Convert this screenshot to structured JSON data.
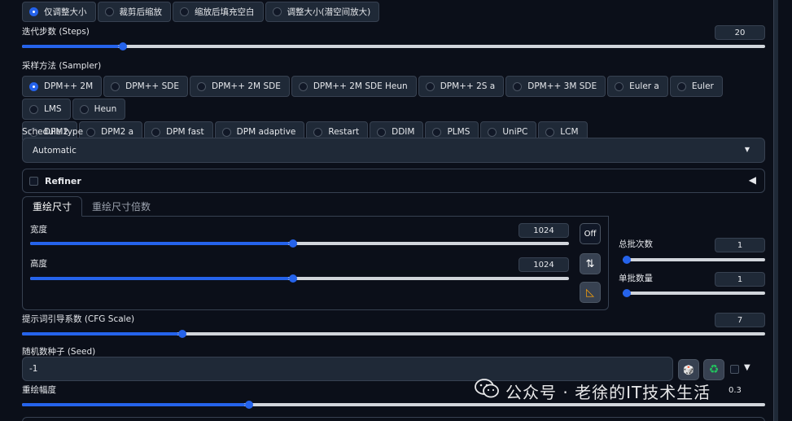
{
  "resize_mode": {
    "options": [
      "仅调整大小",
      "裁剪后缩放",
      "缩放后填充空白",
      "调整大小(潜空间放大)"
    ],
    "selected": 0
  },
  "steps": {
    "label": "迭代步数 (Steps)",
    "value": "20",
    "fraction": 0.13
  },
  "sampler": {
    "label": "采样方法 (Sampler)",
    "row1": [
      "DPM++ 2M",
      "DPM++ SDE",
      "DPM++ 2M SDE",
      "DPM++ 2M SDE Heun",
      "DPM++ 2S a",
      "DPM++ 3M SDE",
      "Euler a",
      "Euler",
      "LMS",
      "Heun"
    ],
    "row2": [
      "DPM2",
      "DPM2 a",
      "DPM fast",
      "DPM adaptive",
      "Restart",
      "DDIM",
      "PLMS",
      "UniPC",
      "LCM"
    ],
    "selected": "DPM++ 2M"
  },
  "schedule": {
    "label": "Schedule type",
    "value": "Automatic"
  },
  "refiner": {
    "label": "Refiner",
    "toggle": "◀"
  },
  "size_tabs": [
    "重绘尺寸",
    "重绘尺寸倍数"
  ],
  "width": {
    "label": "宽度",
    "value": "1024",
    "fraction": 0.48
  },
  "height": {
    "label": "高度",
    "value": "1024",
    "fraction": 0.48
  },
  "tools": {
    "off": "Off",
    "swap": "⇅",
    "ratio": "◺"
  },
  "batch_count": {
    "label": "总批次数",
    "value": "1",
    "fraction": 0.0
  },
  "batch_size": {
    "label": "单批数量",
    "value": "1",
    "fraction": 0.0
  },
  "cfg": {
    "label": "提示词引导系数 (CFG Scale)",
    "value": "7",
    "fraction": 0.21
  },
  "seed": {
    "label": "随机数种子 (Seed)",
    "value": "-1"
  },
  "seed_tools": {
    "dice": "🎲",
    "recycle": "♻",
    "more": "▼"
  },
  "denoise": {
    "label": "重绘幅度",
    "value": "0.3",
    "fraction": 0.3
  },
  "watermark": {
    "text": "公众号 · 老徐的IT技术生活"
  },
  "colors": {
    "accent": "#2563eb",
    "bg": "#0b0f19",
    "panel": "#1f2937",
    "border": "#374151"
  }
}
